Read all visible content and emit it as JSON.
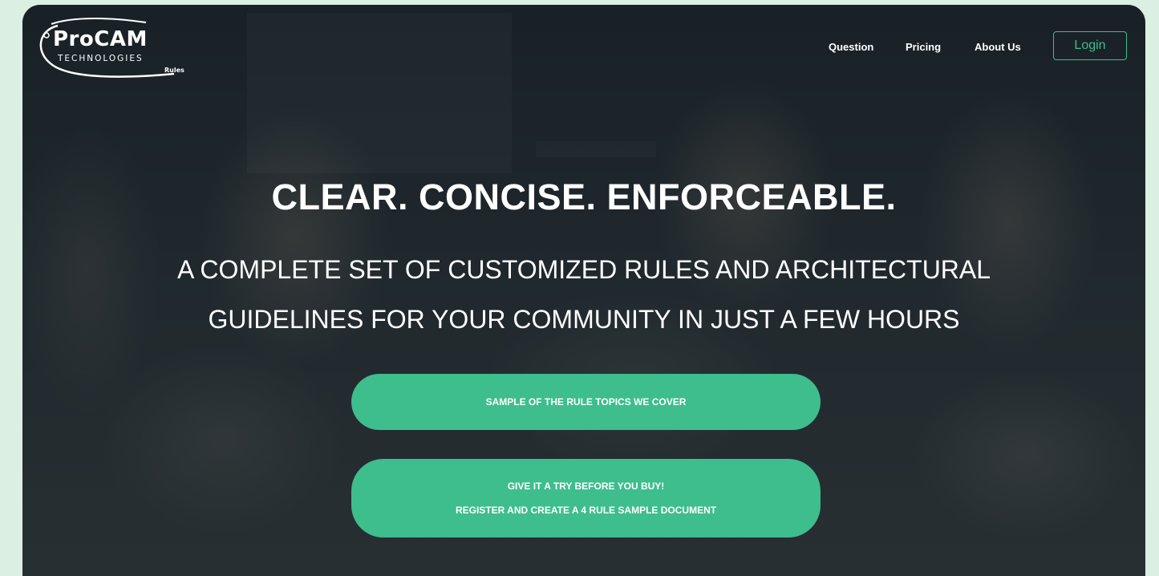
{
  "header": {
    "logo": {
      "brand": "ProCAM",
      "tagline": "TECHNOLOGIES",
      "product": "Rules"
    },
    "nav": [
      {
        "label": "Question"
      },
      {
        "label": "Pricing"
      },
      {
        "label": "About Us"
      }
    ],
    "login_label": "Login"
  },
  "hero": {
    "headline": "CLEAR. CONCISE. ENFORCEABLE.",
    "subheadline_lines": [
      "A COMPLETE SET OF CUSTOMIZED RULES AND ARCHITECTURAL",
      "GUIDELINES FOR YOUR COMMUNITY IN JUST A FEW HOURS"
    ],
    "cta_topics": "SAMPLE OF THE RULE TOPICS WE COVER",
    "cta_trial": {
      "line1": "GIVE IT A TRY BEFORE YOU BUY!",
      "line2": "REGISTER AND CREATE A 4 RULE SAMPLE DOCUMENT"
    }
  },
  "colors": {
    "accent": "#3ebd8d",
    "page_bg": "#dcefe3",
    "hero_overlay": "#1d252c"
  }
}
